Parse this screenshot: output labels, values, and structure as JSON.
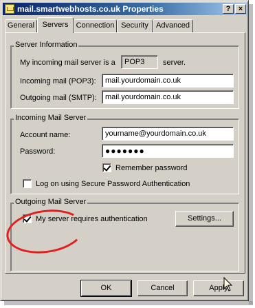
{
  "window": {
    "title": "mail.smartwebhosts.co.uk Properties",
    "help_label": "?",
    "close_label": "×"
  },
  "tabs": [
    {
      "label": "General"
    },
    {
      "label": "Servers",
      "active": true
    },
    {
      "label": "Connection"
    },
    {
      "label": "Security"
    },
    {
      "label": "Advanced"
    }
  ],
  "server_info": {
    "title": "Server Information",
    "incoming_prefix": "My incoming mail server is a",
    "server_type": "POP3",
    "incoming_suffix": "server.",
    "incoming_label": "Incoming mail (POP3):",
    "incoming_value": "mail.yourdomain.co.uk",
    "outgoing_label": "Outgoing mail (SMTP):",
    "outgoing_value": "mail.yourdomain.co.uk"
  },
  "incoming_server": {
    "title": "Incoming Mail Server",
    "account_label": "Account name:",
    "account_value": "yourname@yourdomain.co.uk",
    "password_label": "Password:",
    "password_value": "●●●●●●●",
    "remember_label": "Remember password",
    "remember_checked": true,
    "spa_label": "Log on using Secure Password Authentication",
    "spa_checked": false
  },
  "outgoing_server": {
    "title": "Outgoing Mail Server",
    "auth_label": "My server requires authentication",
    "auth_checked": true,
    "settings_label": "Settings..."
  },
  "footer": {
    "ok_label": "OK",
    "cancel_label": "Cancel",
    "apply_label": "Apply"
  },
  "colors": {
    "dialog_face": "#d4d0c8",
    "title_bar_start": "#0a246a",
    "title_bar_end": "#a6caf0",
    "annotation_circle": "#e02020"
  }
}
